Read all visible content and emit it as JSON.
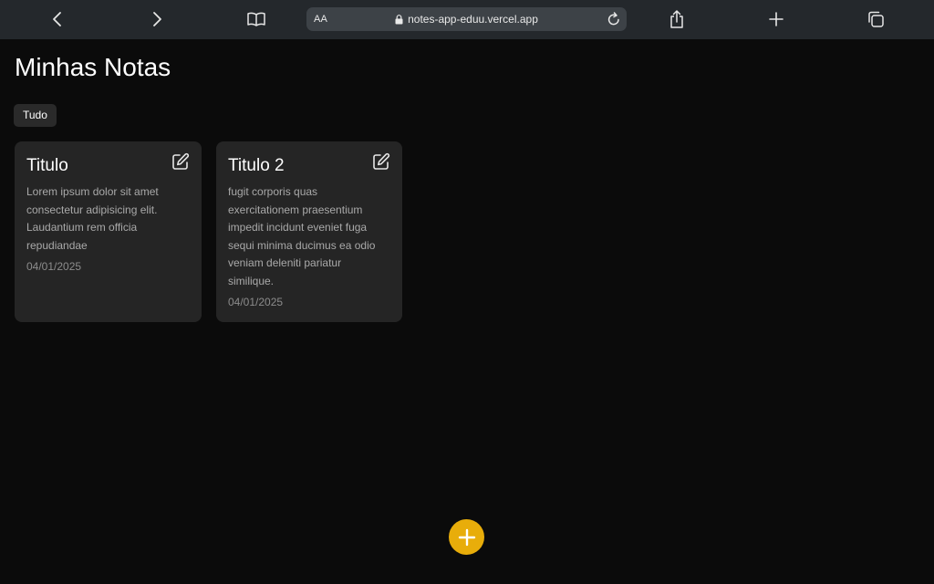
{
  "browser": {
    "reader_label": "AA",
    "url": "notes-app-eduu.vercel.app"
  },
  "page": {
    "title": "Minhas Notas",
    "filter_chip": "Tudo"
  },
  "notes": [
    {
      "title": "Titulo",
      "body": "Lorem ipsum dolor sit amet consectetur adipisicing elit. Laudantium rem officia repudiandae",
      "date": "04/01/2025"
    },
    {
      "title": "Titulo 2",
      "body": "fugit corporis quas exercitationem praesentium impedit incidunt eveniet fuga sequi minima ducimus ea odio veniam deleniti pariatur similique.",
      "date": "04/01/2025"
    }
  ],
  "colors": {
    "fab": "#e8ad0a",
    "card": "#252525",
    "background": "#0b0b0b"
  },
  "icons": [
    "back-icon",
    "forward-icon",
    "book-icon",
    "lock-icon",
    "reload-icon",
    "share-icon",
    "plus-icon",
    "tabs-icon",
    "edit-icon"
  ]
}
